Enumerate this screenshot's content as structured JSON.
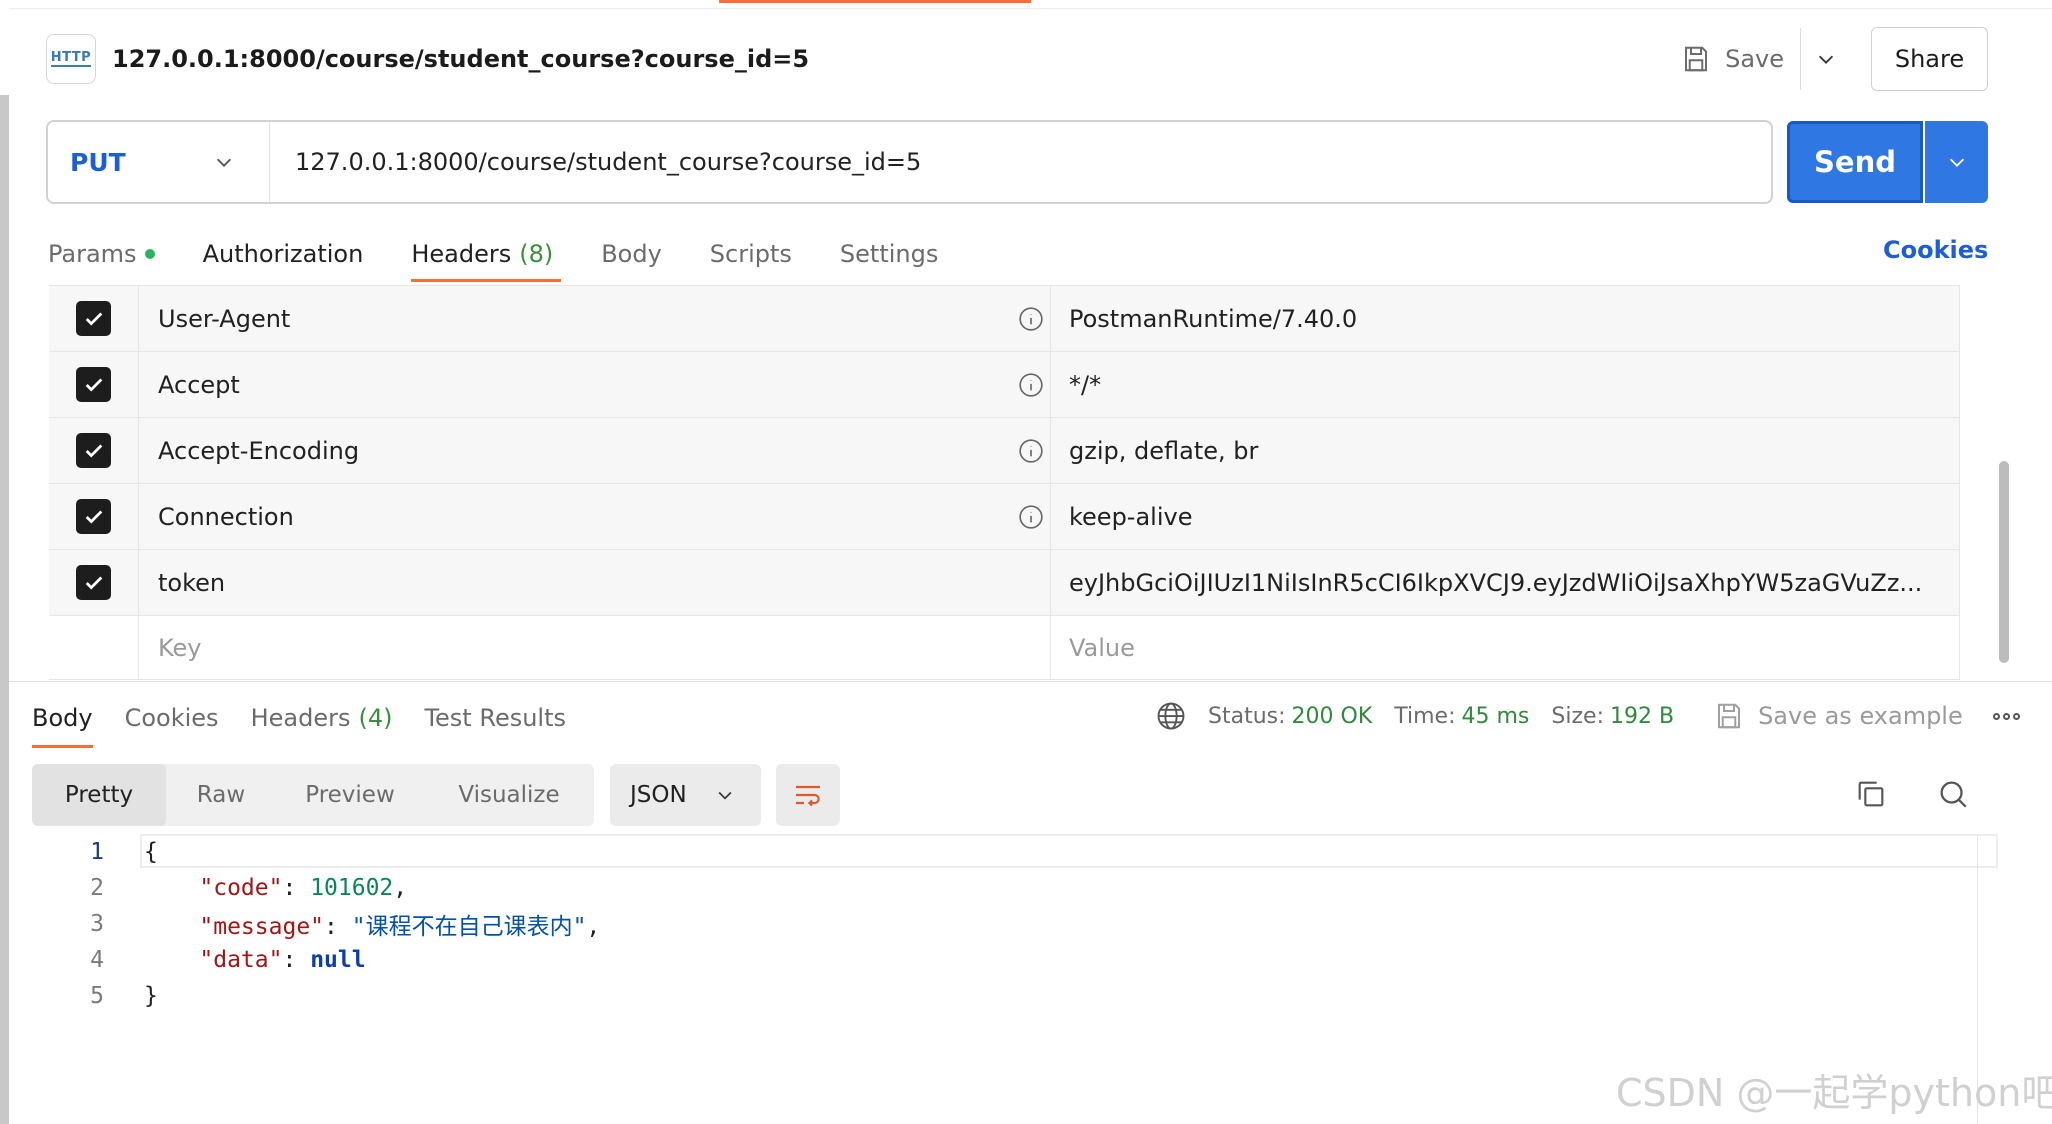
{
  "request": {
    "title": "127.0.0.1:8000/course/student_course?course_id=5",
    "http_icon_text": "HTTP",
    "save_label": "Save",
    "share_label": "Share",
    "method": "PUT",
    "url": "127.0.0.1:8000/course/student_course?course_id=5",
    "send_label": "Send"
  },
  "request_tabs": {
    "params": "Params",
    "authorization": "Authorization",
    "headers": "Headers",
    "headers_count": "(8)",
    "body": "Body",
    "scripts": "Scripts",
    "settings": "Settings",
    "cookies": "Cookies",
    "active": "Headers"
  },
  "headers_table": {
    "rows": [
      {
        "key": "User-Agent",
        "value": "PostmanRuntime/7.40.0",
        "checked": true,
        "info": true
      },
      {
        "key": "Accept",
        "value": "*/*",
        "checked": true,
        "info": true
      },
      {
        "key": "Accept-Encoding",
        "value": "gzip, deflate, br",
        "checked": true,
        "info": true
      },
      {
        "key": "Connection",
        "value": "keep-alive",
        "checked": true,
        "info": true
      },
      {
        "key": "token",
        "value": "eyJhbGciOiJIUzI1NiIsInR5cCI6IkpXVCJ9.eyJzdWIiOiJsaXhpYW5zaGVuZz...",
        "checked": true,
        "info": false
      }
    ],
    "key_placeholder": "Key",
    "value_placeholder": "Value"
  },
  "response": {
    "tabs": {
      "body": "Body",
      "cookies": "Cookies",
      "headers": "Headers",
      "headers_count": "(4)",
      "test_results": "Test Results",
      "active": "Body"
    },
    "status_label": "Status:",
    "status_value": "200 OK",
    "time_label": "Time:",
    "time_value": "45 ms",
    "size_label": "Size:",
    "size_value": "192 B",
    "save_example": "Save as example",
    "views": [
      "Pretty",
      "Raw",
      "Preview",
      "Visualize"
    ],
    "active_view": "Pretty",
    "format": "JSON",
    "code": {
      "line_numbers": [
        "1",
        "2",
        "3",
        "4",
        "5"
      ],
      "open_brace": "{",
      "close_brace": "}",
      "code_key": "\"code\"",
      "code_value": "101602",
      "message_key": "\"message\"",
      "message_value": "\"课程不在自己课表内\"",
      "data_key": "\"data\"",
      "data_value": "null"
    }
  },
  "watermark": "CSDN @一起学python吧",
  "colors": {
    "accent_orange": "#ff6c37",
    "send_blue": "#2f78e3",
    "link_blue": "#1d5ed8",
    "status_green": "#2f8a3c"
  }
}
